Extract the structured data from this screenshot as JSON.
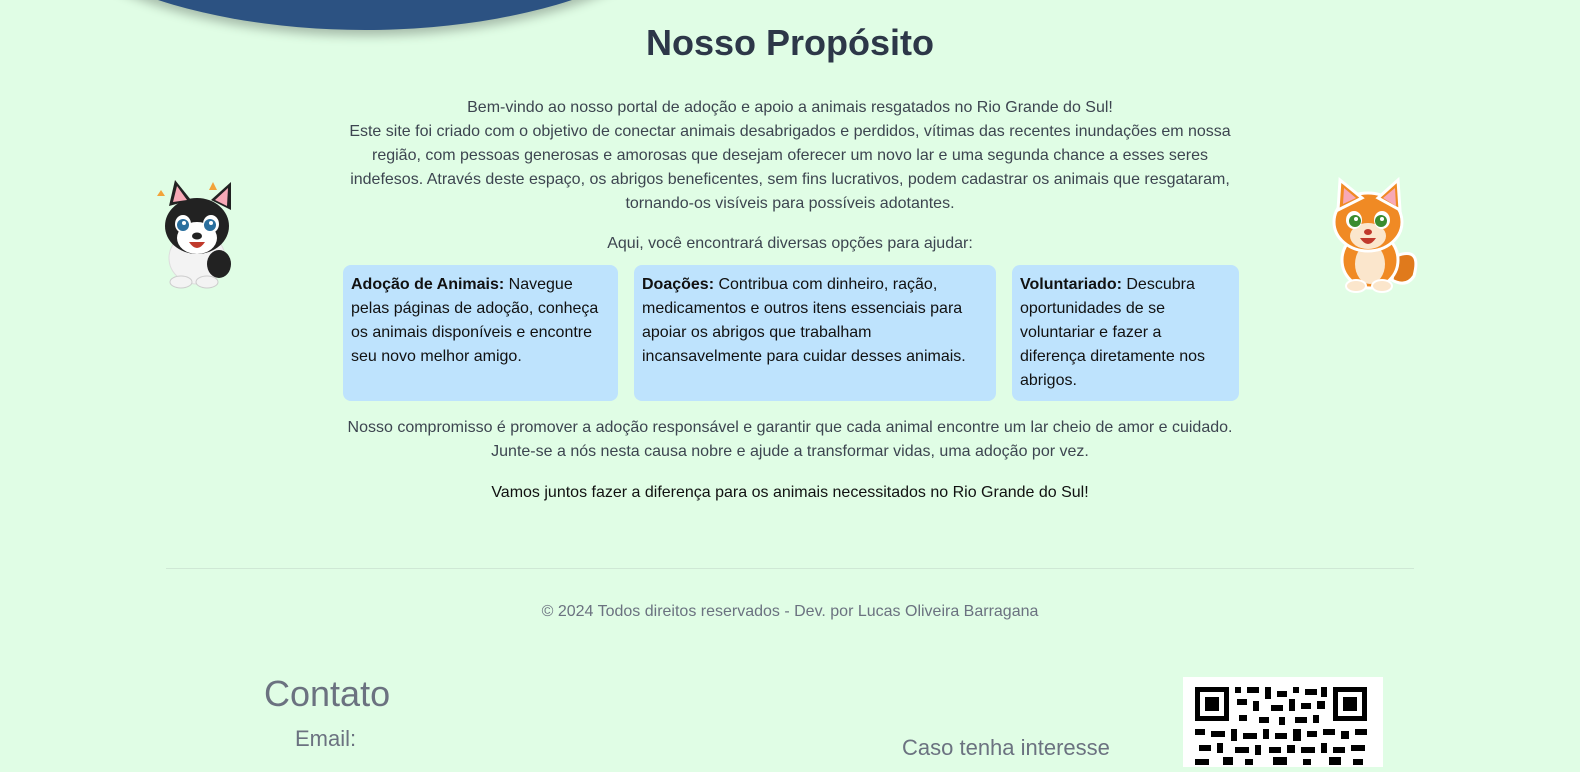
{
  "purpose": {
    "title": "Nosso Propósito",
    "welcome": "Bem-vindo ao nosso portal de adoção e apoio a animais resgatados no Rio Grande do Sul!",
    "description": "Este site foi criado com o objetivo de conectar animais desabrigados e perdidos, vítimas das recentes inundações em nossa região, com pessoas generosas e amorosas que desejam oferecer um novo lar e uma segunda chance a esses seres indefesos. Através deste espaço, os abrigos beneficentes, sem fins lucrativos, podem cadastrar os animais que resgataram, tornando-os visíveis para possíveis adotantes.",
    "help_intro": "Aqui, você encontrará diversas opções para ajudar:",
    "cards": [
      {
        "heading": "Adoção de Animais:",
        "text": " Navegue pelas páginas de adoção, conheça os animais disponíveis e encontre seu novo melhor amigo."
      },
      {
        "heading": "Doações:",
        "text": " Contribua com dinheiro, ração, medicamentos e outros itens essenciais para apoiar os abrigos que trabalham incansavelmente para cuidar desses animais."
      },
      {
        "heading": "Voluntariado:",
        "text": " Descubra oportunidades de se voluntariar e fazer a diferença diretamente nos abrigos."
      }
    ],
    "commitment": "Nosso compromisso é promover a adoção responsável e garantir que cada animal encontre um lar cheio de amor e cuidado.",
    "join": "Junte-se a nós nesta causa nobre e ajude a transformar vidas, uma adoção por vez.",
    "closing": "Vamos juntos fazer a diferença para os animais necessitados no Rio Grande do Sul!"
  },
  "footer": {
    "copyright": "© 2024 Todos direitos reservados - Dev. por Lucas Oliveira Barragana"
  },
  "contact": {
    "title": "Contato",
    "email_label": "Email:",
    "interest_text": "Caso tenha interesse"
  },
  "icons": {
    "left_pet": "puppy-illustration",
    "right_pet": "kitten-illustration",
    "qr": "qr-code"
  },
  "colors": {
    "background": "#e0fde5",
    "header_wave": "#2c5282",
    "card": "#bee3fd"
  }
}
